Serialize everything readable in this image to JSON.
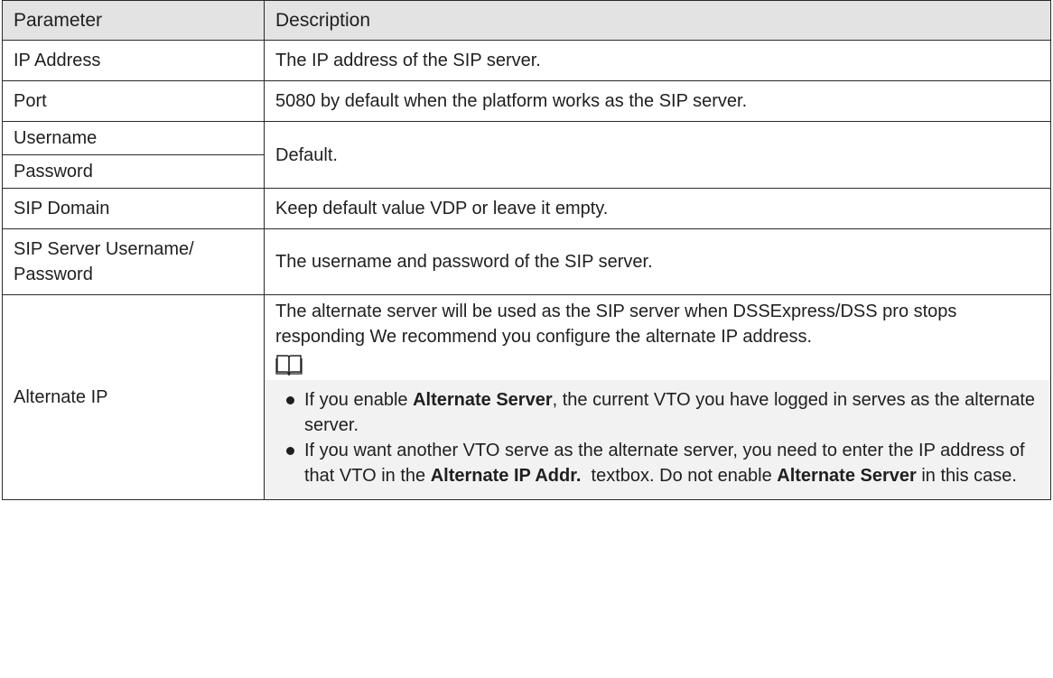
{
  "headers": {
    "parameter": "Parameter",
    "description": "Description"
  },
  "rows": {
    "ip_address": {
      "param": "IP Address",
      "desc": "The IP address of the SIP server."
    },
    "port": {
      "param": "Port",
      "desc": "5080 by default when the platform works as the SIP server."
    },
    "username": {
      "param": "Username"
    },
    "password": {
      "param": "Password"
    },
    "user_pass_desc": "Default.",
    "sip_domain": {
      "param": "SIP Domain",
      "desc": "Keep default value VDP or leave it empty."
    },
    "sip_server_user": {
      "param": "SIP Server Username/ Password",
      "desc": "The username and password of the SIP server."
    },
    "alternate_ip": {
      "param": "Alternate IP",
      "desc": "The alternate server will be used as the SIP server when DSSExpress/DSS pro stops responding We recommend you configure the alternate IP address.",
      "note_icon": "book-icon",
      "bullet1": {
        "pre": "If you enable ",
        "bold": "Alternate Server",
        "post": ", the current VTO you have logged in serves as the alternate server."
      },
      "bullet2": {
        "pre": "If you want another VTO serve as the alternate server, you need to enter the IP address of that VTO in the ",
        "bold1": "Alternate IP Addr.",
        "mid": "  textbox. Do not enable ",
        "bold2": "Alternate Server",
        "post": " in this case."
      }
    }
  }
}
